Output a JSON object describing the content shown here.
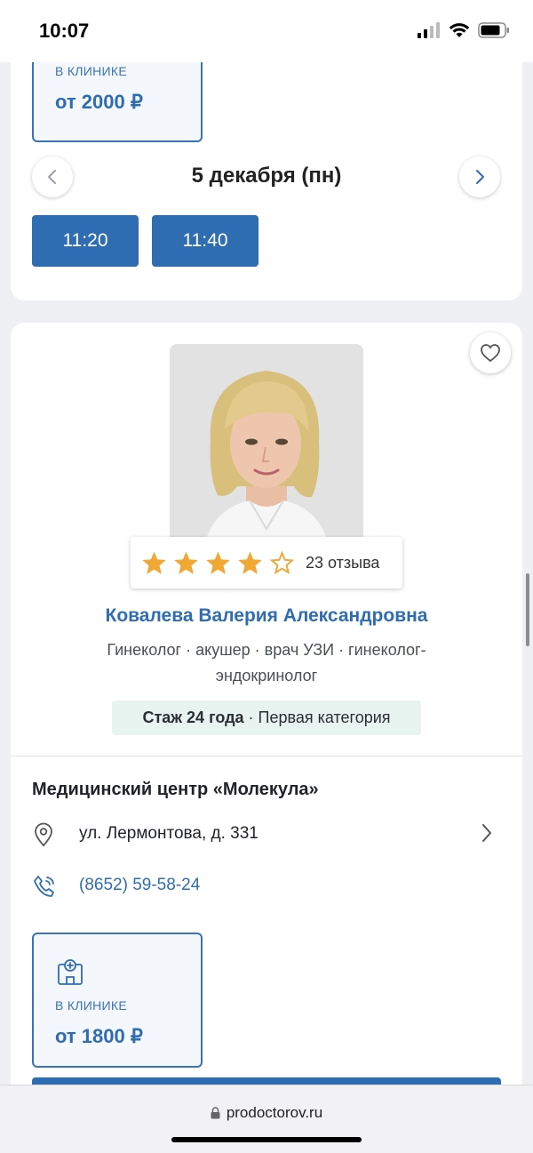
{
  "status_bar": {
    "time": "10:07"
  },
  "top_card": {
    "price_label": "В КЛИНИКЕ",
    "price": "от 2000 ₽",
    "date": "5 декабря (пн)",
    "slots": [
      "11:20",
      "11:40"
    ]
  },
  "doctor": {
    "rating_stars": 4,
    "rating_max": 5,
    "reviews": "23 отзыва",
    "name": "Ковалева Валерия Александровна",
    "specialty_line1": "Гинеколог · акушер · врач УЗИ · гинеколог-",
    "specialty_line2": "эндокринолог",
    "experience_bold": "Стаж 24 года",
    "experience_rest": "· Первая категория"
  },
  "clinic": {
    "name": "Медицинский центр «Молекула»",
    "address": "ул. Лермонтова, д. 331",
    "phone": "(8652) 59-58-24",
    "price_label": "В КЛИНИКЕ",
    "price": "от 1800 ₽"
  },
  "browser": {
    "url": "prodoctorov.ru"
  },
  "colors": {
    "accent": "#2f6db3",
    "star": "#f0a733",
    "experience_bg": "#e7f4ef"
  }
}
